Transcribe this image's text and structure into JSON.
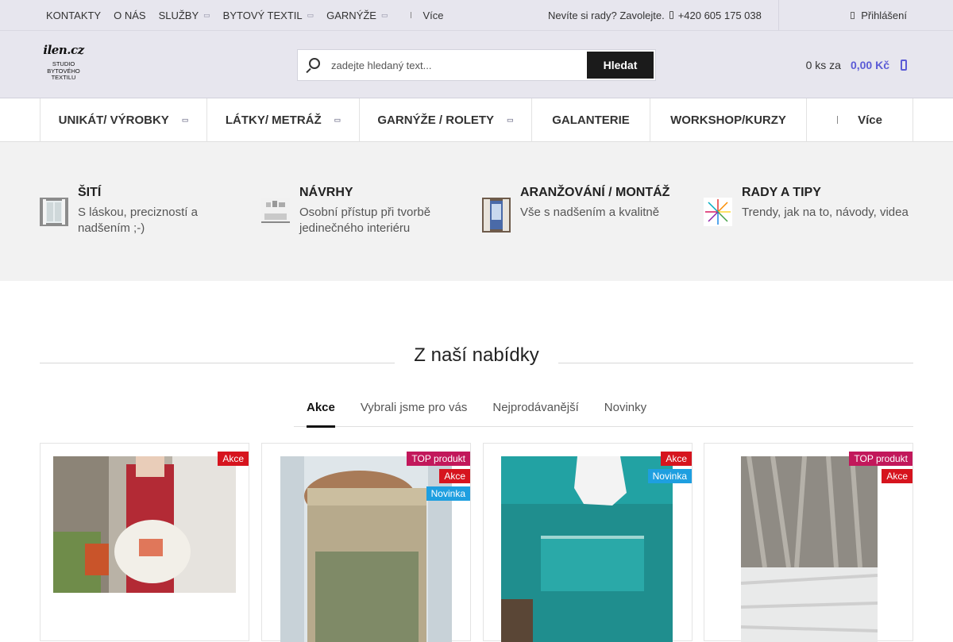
{
  "topbar": {
    "nav": [
      {
        "label": "KONTAKTY",
        "has_caret": false
      },
      {
        "label": "O NÁS",
        "has_caret": false
      },
      {
        "label": "SLUŽBY",
        "has_caret": true
      },
      {
        "label": "BYTOVÝ TEXTIL",
        "has_caret": true
      },
      {
        "label": "GARNÝŽE",
        "has_caret": true
      }
    ],
    "more_label": "Více",
    "contact_text": "Nevíte si rady? Zavolejte.",
    "phone": "+420 605 175 038",
    "login_label": "Přihlášení"
  },
  "header": {
    "logo_brand": "ilen.cz",
    "logo_line1": "STUDIO",
    "logo_line2": "BYTOVÉHO",
    "logo_line3": "TEXTILU",
    "search_placeholder": "zadejte hledaný text...",
    "search_button": "Hledat",
    "cart_qty": "0 ks za",
    "cart_price": "0,00 Kč"
  },
  "mainnav": [
    {
      "label": "UNIKÁT/ VÝROBKY",
      "has_caret": true
    },
    {
      "label": "LÁTKY/ METRÁŽ",
      "has_caret": true
    },
    {
      "label": "GARNÝŽE / ROLETY",
      "has_caret": true
    },
    {
      "label": "GALANTERIE",
      "has_caret": false
    },
    {
      "label": "WORKSHOP/KURZY",
      "has_caret": false
    },
    {
      "label": "Více",
      "has_caret": false
    }
  ],
  "features": [
    {
      "title": "ŠITÍ",
      "desc": "S láskou, precizností a nadšením ;-)"
    },
    {
      "title": "NÁVRHY",
      "desc": "Osobní přístup při tvorbě jedinečného interiéru"
    },
    {
      "title": "ARANŽOVÁNÍ / MONTÁŽ",
      "desc": "Vše s nadšením a kvalitně"
    },
    {
      "title": "RADY A TIPY",
      "desc": "Trendy, jak na to, návody, videa"
    }
  ],
  "section_title": "Z naší nabídky",
  "tabs": [
    "Akce",
    "Vybrali jsme pro vás",
    "Nejprodávanější",
    "Novinky"
  ],
  "active_tab": "Akce",
  "badges": {
    "akce": "Akce",
    "top": "TOP produkt",
    "new": "Novinka"
  },
  "colors": {
    "accent": "#5b5bd6",
    "akce": "#d6141e",
    "top": "#c2185b",
    "novinka": "#1e9fe0"
  }
}
